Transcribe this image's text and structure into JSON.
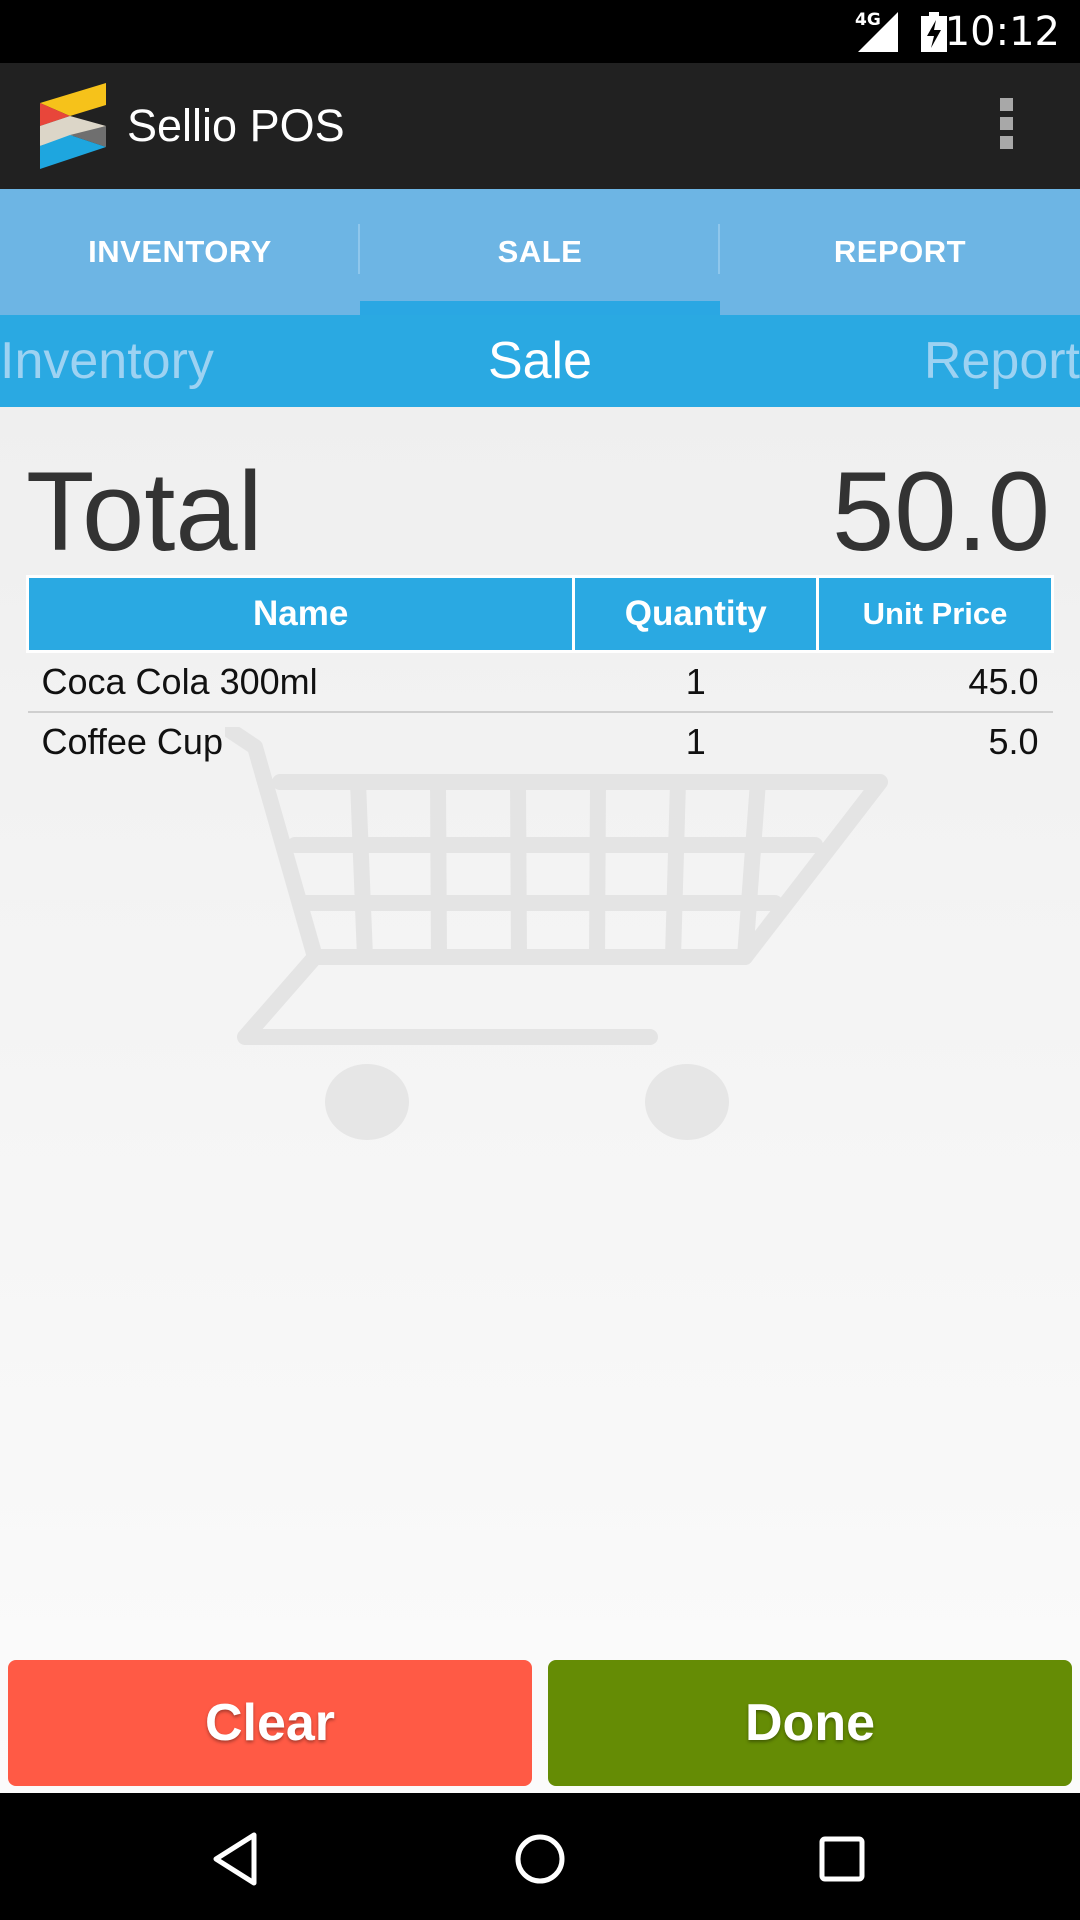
{
  "status_bar": {
    "time": "10:12",
    "network": "4G"
  },
  "app": {
    "title": "Sellio POS"
  },
  "tabs": [
    {
      "label": "INVENTORY"
    },
    {
      "label": "SALE"
    },
    {
      "label": "REPORT"
    }
  ],
  "title_strip": {
    "prev": "Inventory",
    "current": "Sale",
    "next": "Report"
  },
  "sale": {
    "total_label": "Total",
    "total_value": "50.0",
    "columns": [
      "Name",
      "Quantity",
      "Unit Price"
    ],
    "rows": [
      {
        "name": "Coca Cola 300ml",
        "quantity": "1",
        "unit_price": "45.0"
      },
      {
        "name": "Coffee Cup",
        "quantity": "1",
        "unit_price": "5.0"
      }
    ]
  },
  "buttons": {
    "clear": "Clear",
    "done": "Done"
  },
  "colors": {
    "accent": "#2aa9e2",
    "tab_bar": "#6db5e4",
    "clear_button": "#ff5a45",
    "done_button": "#658c05"
  }
}
